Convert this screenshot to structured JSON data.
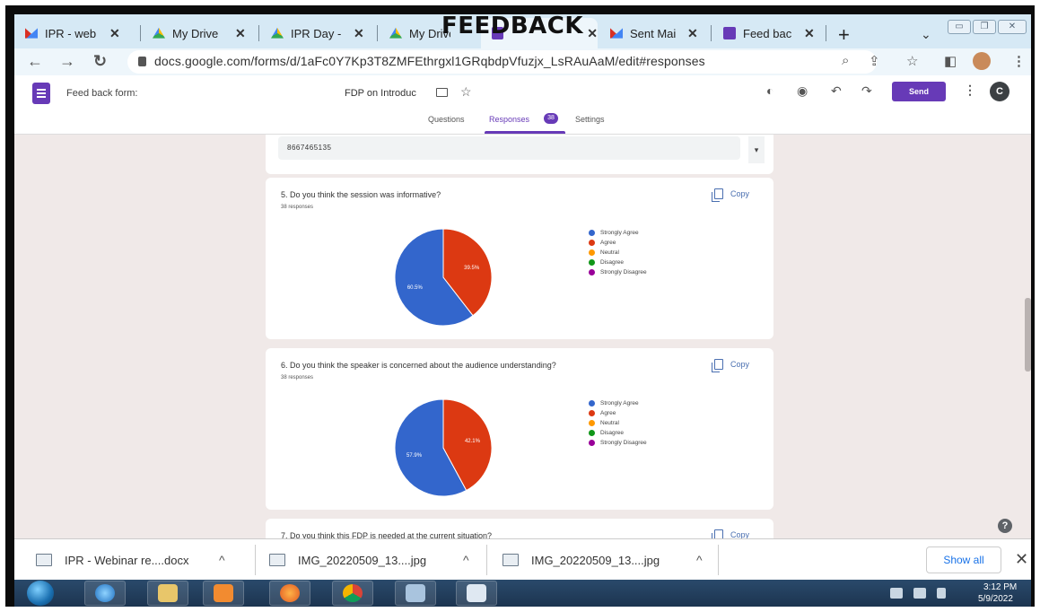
{
  "overlay_heading": "FEEDBACK",
  "browser": {
    "tabs": [
      {
        "label": "IPR - web",
        "icon": "gmail-icon",
        "close": "✕"
      },
      {
        "label": "My Drive",
        "icon": "drive-icon",
        "close": "✕"
      },
      {
        "label": "IPR Day -",
        "icon": "drive-icon",
        "close": "✕"
      },
      {
        "label": "My Drive",
        "icon": "drive-icon",
        "close": "✕"
      },
      {
        "label": "",
        "icon": "forms-icon",
        "close": "✕"
      },
      {
        "label": "Sent Mai",
        "icon": "gmail-icon",
        "close": "✕"
      },
      {
        "label": "Feed bac",
        "icon": "forms-icon",
        "close": "✕"
      }
    ],
    "new_tab": "+",
    "tab_menu": "⌄",
    "url": "docs.google.com/forms/d/1aFc0Y7Kp3T8ZMFEthrgxl1GRqbdpVfuzjx_LsRAuAaM/edit#responses"
  },
  "forms_header": {
    "form_name": "Feed back form:",
    "doc_title": "FDP on Introduc",
    "send_label": "Send",
    "avatar_letter": "C",
    "tabs": {
      "questions": "Questions",
      "responses": "Responses",
      "settings": "Settings"
    },
    "responses_badge": "38"
  },
  "phone_answer": "8667465135",
  "questions": [
    {
      "title": "5. Do you think the session was informative?",
      "count": "38 responses",
      "copy_label": "Copy",
      "slice_labels": {
        "strongly_agree": "60.5%",
        "agree": "39.5%"
      }
    },
    {
      "title": "6. Do you think the speaker is concerned about the audience understanding?",
      "count": "38 responses",
      "copy_label": "Copy",
      "slice_labels": {
        "strongly_agree": "57.9%",
        "agree": "42.1%"
      }
    },
    {
      "title": "7. Do you think this FDP is needed at the current situation?",
      "copy_label": "Copy"
    }
  ],
  "legend": [
    "Strongly Agree",
    "Agree",
    "Neutral",
    "Disagree",
    "Strongly Disagree"
  ],
  "legend_colors": [
    "#3366cc",
    "#dc3912",
    "#ff9900",
    "#109618",
    "#990099"
  ],
  "chart_data": [
    {
      "type": "pie",
      "categories": [
        "Strongly Agree",
        "Agree",
        "Neutral",
        "Disagree",
        "Strongly Disagree"
      ],
      "values": [
        60.5,
        39.5,
        0,
        0,
        0
      ]
    },
    {
      "type": "pie",
      "categories": [
        "Strongly Agree",
        "Agree",
        "Neutral",
        "Disagree",
        "Strongly Disagree"
      ],
      "values": [
        57.9,
        42.1,
        0,
        0,
        0
      ]
    }
  ],
  "downloads": [
    {
      "name": "IPR - Webinar re....docx",
      "caret": "^"
    },
    {
      "name": "IMG_20220509_13....jpg",
      "caret": "^"
    },
    {
      "name": "IMG_20220509_13....jpg",
      "caret": "^"
    }
  ],
  "show_all": "Show all",
  "shelf_close": "✕",
  "taskbar": {
    "time": "3:12 PM",
    "date": "5/9/2022"
  }
}
